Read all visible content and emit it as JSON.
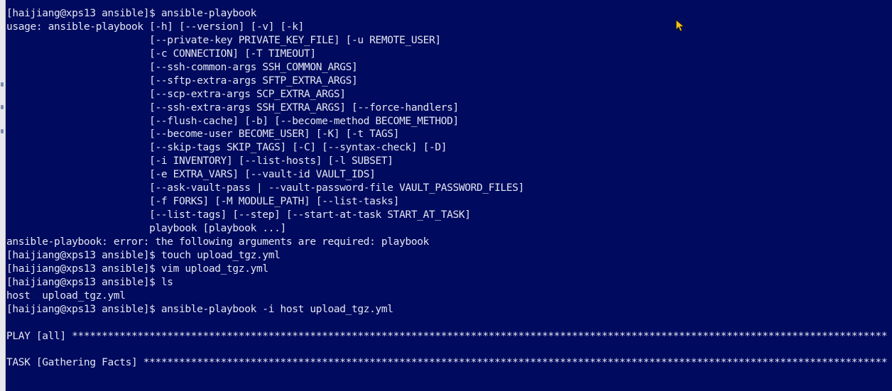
{
  "terminal": {
    "colors": {
      "background": "#000a5e",
      "text": "#e3e6f2",
      "cursor": "#f5c21b"
    },
    "lines": [
      "[haijiang@xps13 ansible]$ ansible-playbook",
      "usage: ansible-playbook [-h] [--version] [-v] [-k]",
      "                        [--private-key PRIVATE_KEY_FILE] [-u REMOTE_USER]",
      "                        [-c CONNECTION] [-T TIMEOUT]",
      "                        [--ssh-common-args SSH_COMMON_ARGS]",
      "                        [--sftp-extra-args SFTP_EXTRA_ARGS]",
      "                        [--scp-extra-args SCP_EXTRA_ARGS]",
      "                        [--ssh-extra-args SSH_EXTRA_ARGS] [--force-handlers]",
      "                        [--flush-cache] [-b] [--become-method BECOME_METHOD]",
      "                        [--become-user BECOME_USER] [-K] [-t TAGS]",
      "                        [--skip-tags SKIP_TAGS] [-C] [--syntax-check] [-D]",
      "                        [-i INVENTORY] [--list-hosts] [-l SUBSET]",
      "                        [-e EXTRA_VARS] [--vault-id VAULT_IDS]",
      "                        [--ask-vault-pass | --vault-password-file VAULT_PASSWORD_FILES]",
      "                        [-f FORKS] [-M MODULE_PATH] [--list-tasks]",
      "                        [--list-tags] [--step] [--start-at-task START_AT_TASK]",
      "                        playbook [playbook ...]",
      "ansible-playbook: error: the following arguments are required: playbook",
      "[haijiang@xps13 ansible]$ touch upload_tgz.yml",
      "[haijiang@xps13 ansible]$ vim upload_tgz.yml",
      "[haijiang@xps13 ansible]$ ls",
      "host  upload_tgz.yml",
      "[haijiang@xps13 ansible]$ ansible-playbook -i host upload_tgz.yml",
      "",
      "PLAY [all] *****************************************************************************************************************************************",
      "",
      "TASK [Gathering Facts] *****************************************************************************************************************************"
    ]
  }
}
